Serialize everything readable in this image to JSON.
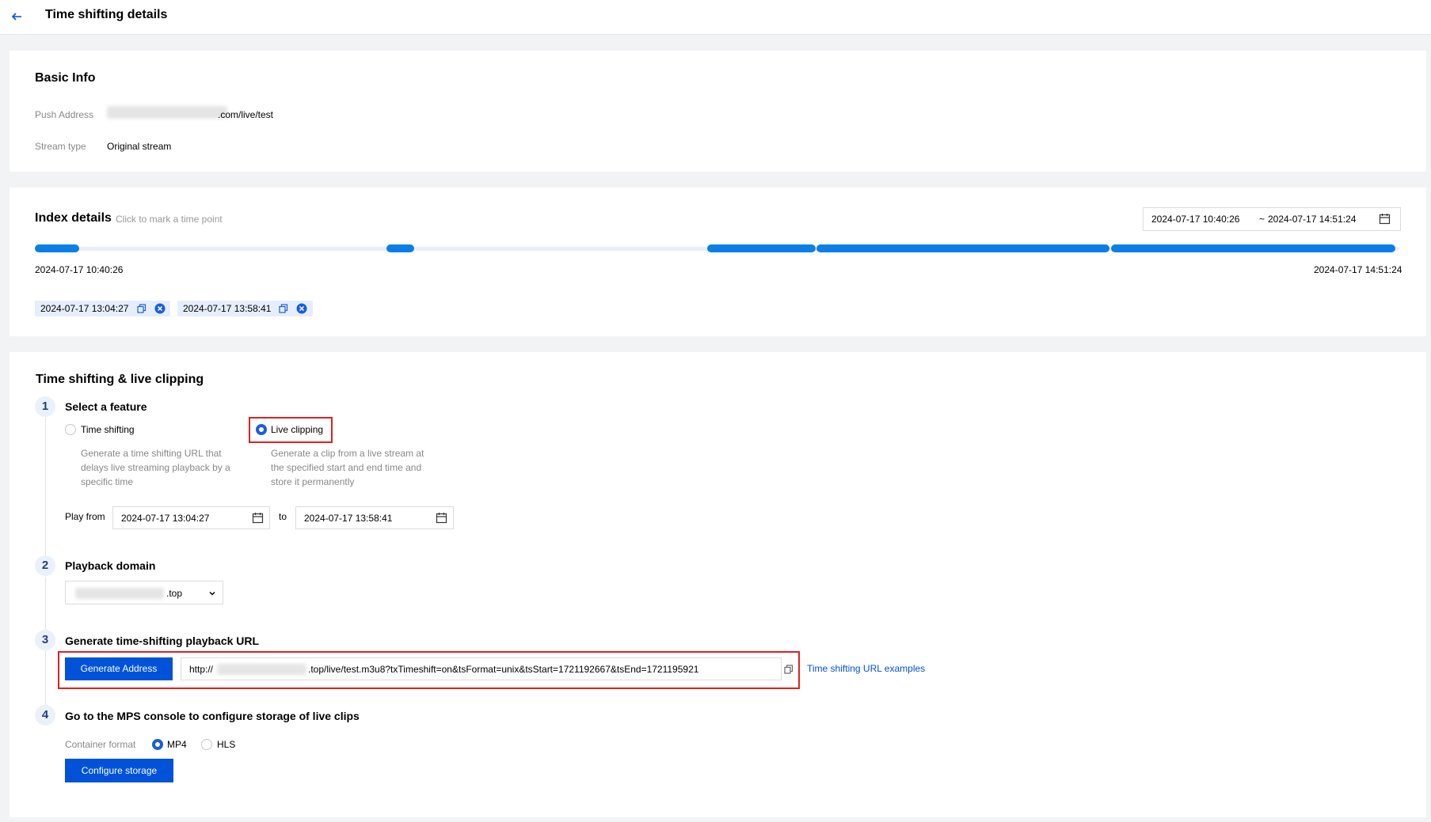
{
  "header": {
    "title": "Time shifting details"
  },
  "basic_info": {
    "title": "Basic Info",
    "push_address_label": "Push Address",
    "push_address_value": ".com/live/test",
    "stream_type_label": "Stream type",
    "stream_type_value": "Original stream"
  },
  "index_details": {
    "title": "Index details",
    "hint": "Click to mark a time point",
    "range_start": "2024-07-17 10:40:26",
    "range_sep": "~",
    "range_end": "2024-07-17 14:51:24",
    "axis_start": "2024-07-17 10:40:26",
    "axis_end": "2024-07-17 14:51:24",
    "marks": [
      "2024-07-17 13:04:27",
      "2024-07-17 13:58:41"
    ]
  },
  "ts": {
    "title": "Time shifting & live clipping",
    "step1": {
      "num": "1",
      "title": "Select a feature",
      "opt1_label": "Time shifting",
      "opt1_desc": [
        "Generate a time shifting URL that",
        "delays live streaming playback by a",
        "specific time"
      ],
      "opt2_label": "Live clipping",
      "opt2_desc": [
        "Generate a clip from a live stream at",
        "the specified start and end time and",
        "store it permanently"
      ],
      "play_from_label": "Play from",
      "from_value": "2024-07-17 13:04:27",
      "to_label": "to",
      "to_value": "2024-07-17 13:58:41"
    },
    "step2": {
      "num": "2",
      "title": "Playback domain",
      "domain_suffix": ".top"
    },
    "step3": {
      "num": "3",
      "title": "Generate time-shifting playback URL",
      "button": "Generate Address",
      "url_prefix": "http://",
      "url_suffix": ".top/live/test.m3u8?txTimeshift=on&tsFormat=unix&tsStart=1721192667&tsEnd=1721195921",
      "examples_link": "Time shifting URL examples"
    },
    "step4": {
      "num": "4",
      "title": "Go to the MPS console to configure storage of live clips",
      "container_label": "Container format",
      "opt_mp4": "MP4",
      "opt_hls": "HLS",
      "button": "Configure storage"
    }
  }
}
